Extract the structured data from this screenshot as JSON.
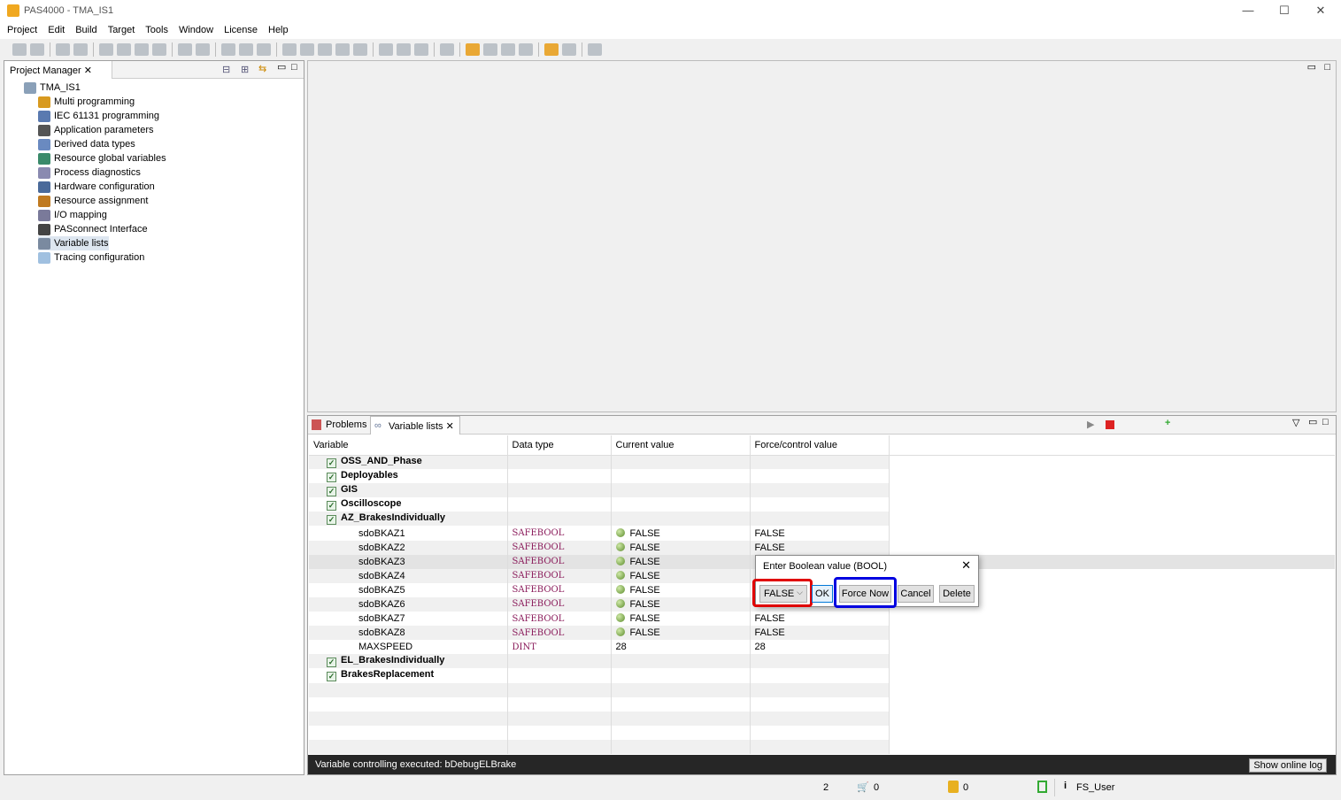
{
  "window": {
    "title": "PAS4000 - TMA_IS1",
    "minimize": "—",
    "maximize": "☐",
    "close": "✕"
  },
  "menu": [
    "Project",
    "Edit",
    "Build",
    "Target",
    "Tools",
    "Window",
    "License",
    "Help"
  ],
  "project_manager": {
    "tab": "Project Manager",
    "root": "TMA_IS1",
    "items": [
      {
        "label": "Multi programming",
        "color": "#d89a20"
      },
      {
        "label": "IEC 61131 programming",
        "color": "#5a7ab0"
      },
      {
        "label": "Application parameters",
        "color": "#555555"
      },
      {
        "label": "Derived data types",
        "color": "#6a8ac0"
      },
      {
        "label": "Resource global variables",
        "color": "#3a8a6a"
      },
      {
        "label": "Process diagnostics",
        "color": "#8a8ab0"
      },
      {
        "label": "Hardware configuration",
        "color": "#4a6a9a"
      },
      {
        "label": "Resource assignment",
        "color": "#c07a20"
      },
      {
        "label": "I/O mapping",
        "color": "#7a7a9a"
      },
      {
        "label": "PASconnect Interface",
        "color": "#444444"
      },
      {
        "label": "Variable lists",
        "color": "#7a8aa0",
        "selected": true
      },
      {
        "label": "Tracing configuration",
        "color": "#a0c0e0"
      }
    ]
  },
  "bottom_tabs": {
    "problems": "Problems",
    "variable_lists": "Variable lists"
  },
  "table": {
    "headers": [
      "Variable",
      "Data type",
      "Current value",
      "Force/control value"
    ],
    "rows": [
      {
        "group": true,
        "name": "OSS_AND_Phase"
      },
      {
        "group": true,
        "name": "Deployables"
      },
      {
        "group": true,
        "name": "GIS"
      },
      {
        "group": true,
        "name": "Oscilloscope"
      },
      {
        "group": true,
        "name": "AZ_BrakesIndividually"
      },
      {
        "name": "sdoBKAZ1",
        "type": "SAFEBOOL",
        "current": "FALSE",
        "force": "FALSE",
        "led": true
      },
      {
        "name": "sdoBKAZ2",
        "type": "SAFEBOOL",
        "current": "FALSE",
        "force": "FALSE",
        "led": true
      },
      {
        "name": "sdoBKAZ3",
        "type": "SAFEBOOL",
        "current": "FALSE",
        "force": "F",
        "led": true,
        "selected": true
      },
      {
        "name": "sdoBKAZ4",
        "type": "SAFEBOOL",
        "current": "FALSE",
        "force": "",
        "led": true
      },
      {
        "name": "sdoBKAZ5",
        "type": "SAFEBOOL",
        "current": "FALSE",
        "force": "",
        "led": true
      },
      {
        "name": "sdoBKAZ6",
        "type": "SAFEBOOL",
        "current": "FALSE",
        "force": "",
        "led": true
      },
      {
        "name": "sdoBKAZ7",
        "type": "SAFEBOOL",
        "current": "FALSE",
        "force": "FALSE",
        "led": true
      },
      {
        "name": "sdoBKAZ8",
        "type": "SAFEBOOL",
        "current": "FALSE",
        "force": "FALSE",
        "led": true
      },
      {
        "name": "MAXSPEED",
        "type": "DINT",
        "current": "28",
        "force": "28"
      },
      {
        "group": true,
        "name": "EL_BrakesIndividually"
      },
      {
        "group": true,
        "name": "BrakesReplacement"
      }
    ]
  },
  "dialog": {
    "title": "Enter Boolean value (BOOL)",
    "value": "FALSE",
    "ok": "OK",
    "force_now": "Force Now",
    "cancel": "Cancel",
    "delete": "Delete",
    "highlight_red": "#e00000",
    "highlight_blue": "#0000e0"
  },
  "log": {
    "message": "Variable controlling executed: bDebugELBrake",
    "show_log": "Show online log"
  },
  "status": {
    "count": "2",
    "cart": "0",
    "coins": "0",
    "user": "FS_User"
  }
}
